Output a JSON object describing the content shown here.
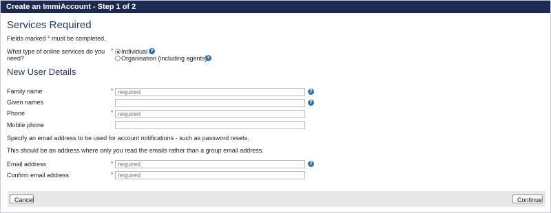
{
  "window": {
    "title": "Create an ImmiAccount - Step 1 of 2"
  },
  "services": {
    "heading": "Services Required",
    "note_prefix": "Fields marked ",
    "note_star": "*",
    "note_suffix": " must be completed.",
    "question_line1": "What type of online services do you",
    "question_line2": "need?",
    "options": [
      {
        "label": "Individual",
        "selected": true
      },
      {
        "label": "Organisation (including agents)",
        "selected": false
      }
    ]
  },
  "user": {
    "heading": "New User Details",
    "fields": {
      "family_name": {
        "label": "Family name",
        "placeholder": "required",
        "value": ""
      },
      "given_names": {
        "label": "Given names",
        "placeholder": "",
        "value": ""
      },
      "phone": {
        "label": "Phone",
        "placeholder": "required",
        "value": ""
      },
      "mobile_phone": {
        "label": "Mobile phone",
        "placeholder": "",
        "value": ""
      },
      "email": {
        "label": "Email address",
        "placeholder": "required",
        "value": ""
      },
      "confirm_email": {
        "label": "Confirm email address",
        "placeholder": "required",
        "value": ""
      }
    },
    "email_info1": "Specify an email address to be used for account notifications - such as password resets.",
    "email_info2": "This should be an address where only you read the emails rather than a group email address."
  },
  "required_marker": "*",
  "help_glyph": "?",
  "icons": {
    "help": "help-icon"
  },
  "colors": {
    "titlebar": "#1b2a50",
    "heading": "#23375c",
    "required": "#c03030",
    "help": "#2f6fb7"
  },
  "buttons": {
    "cancel": "Cancel",
    "continue": "Continue"
  }
}
